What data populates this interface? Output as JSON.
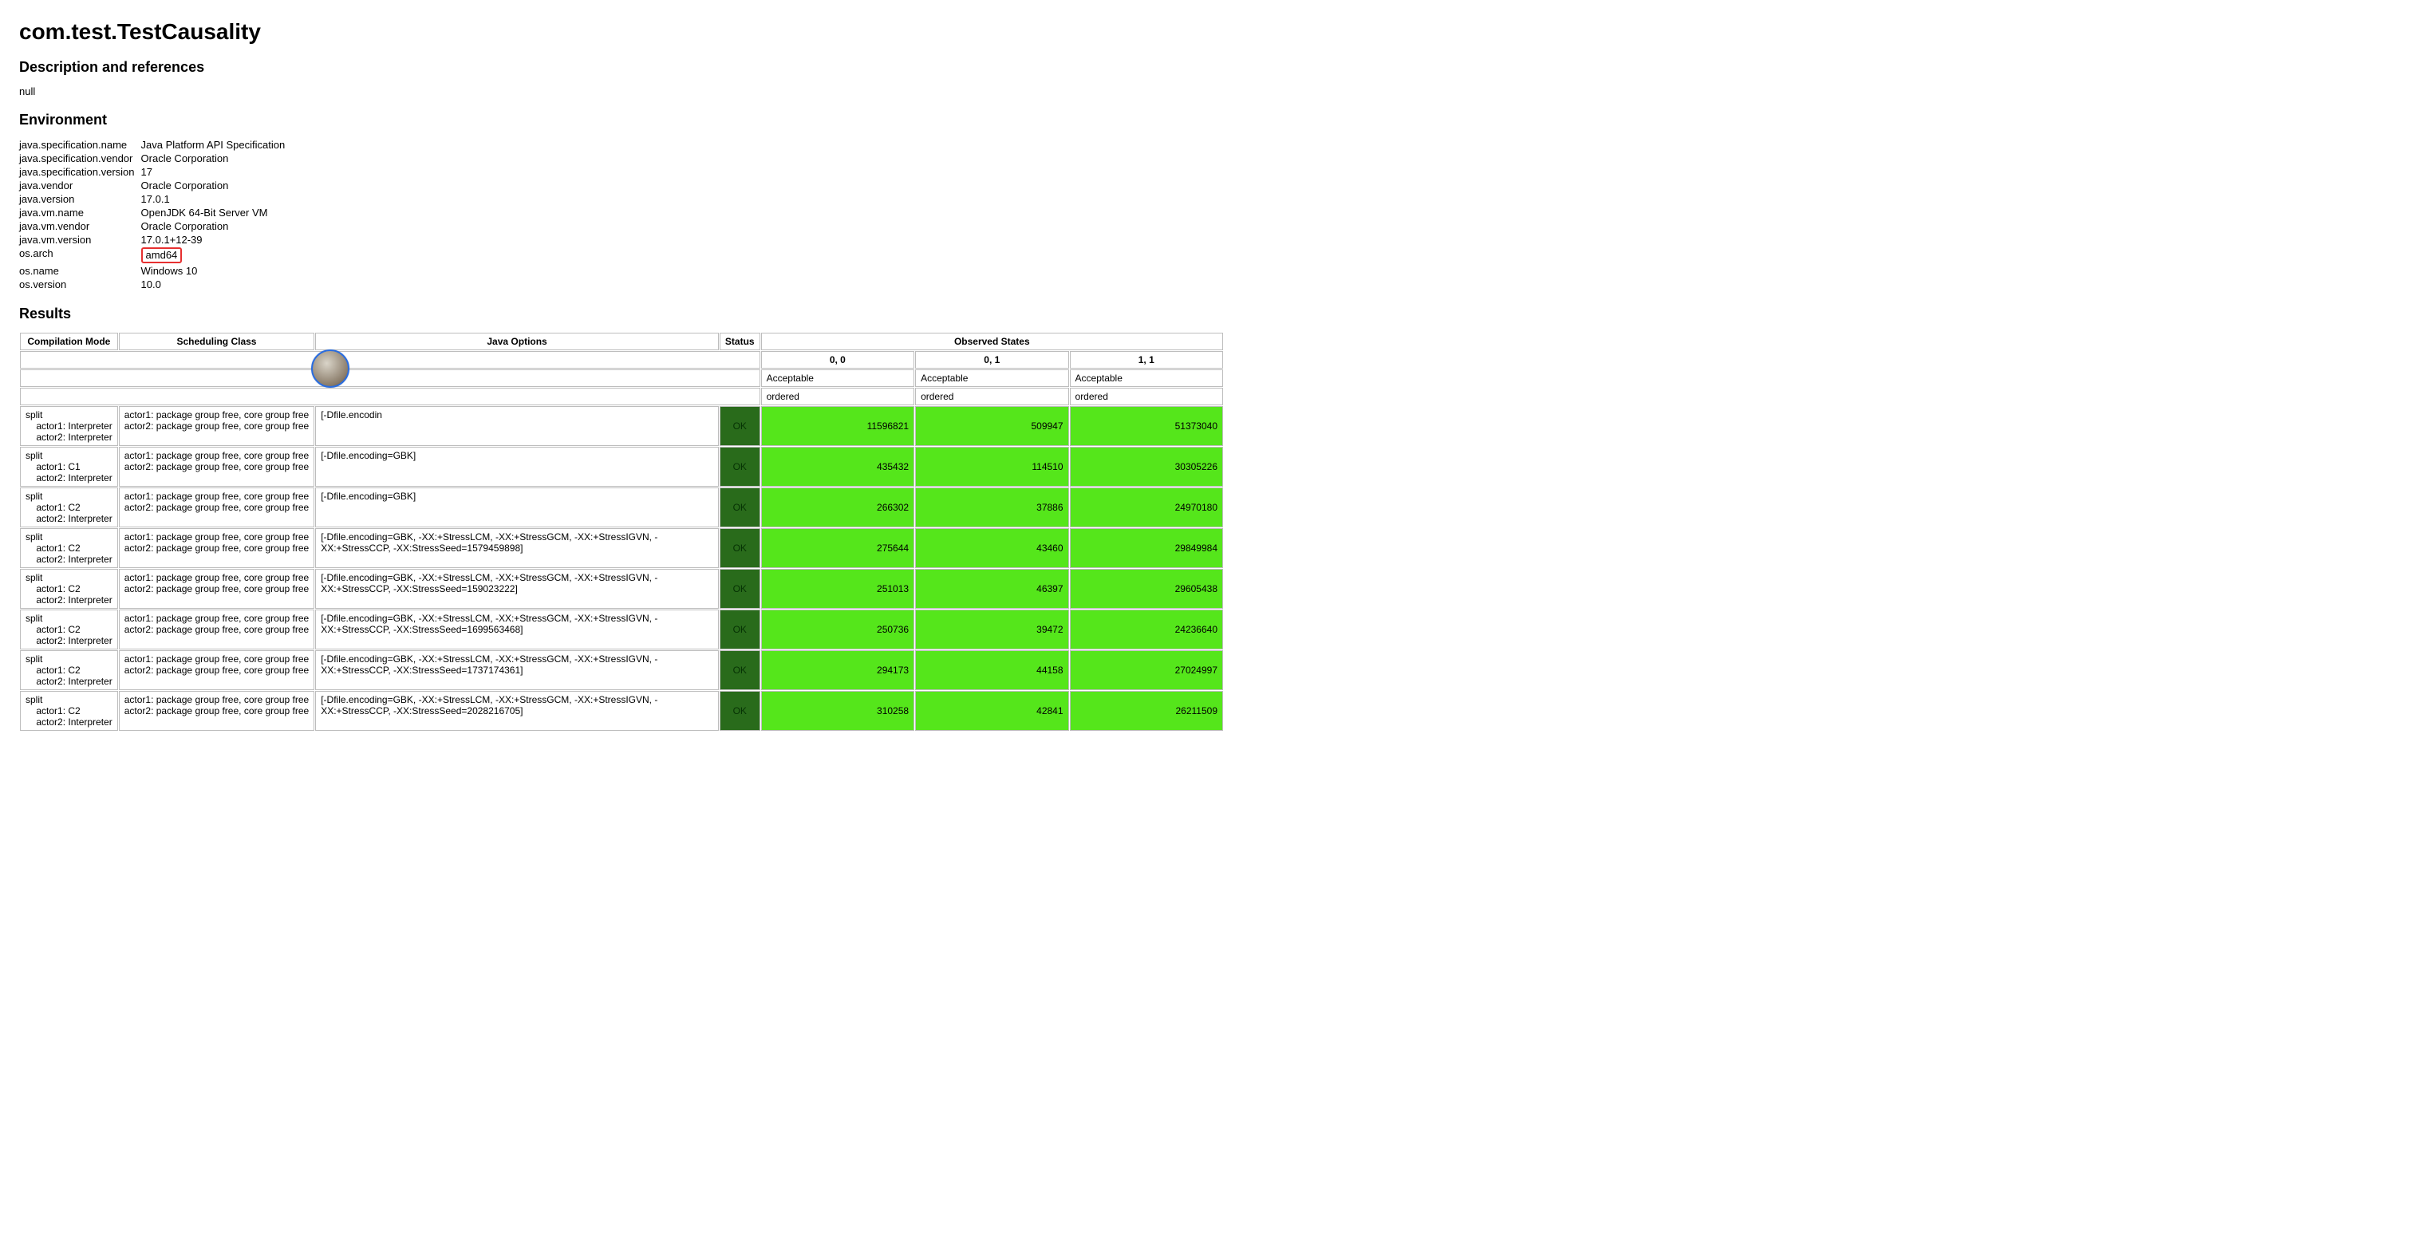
{
  "title": "com.test.TestCausality",
  "descriptionHeading": "Description and references",
  "descriptionText": "null",
  "environmentHeading": "Environment",
  "env": [
    {
      "k": "java.specification.name",
      "v": "Java Platform API Specification"
    },
    {
      "k": "java.specification.vendor",
      "v": "Oracle Corporation"
    },
    {
      "k": "java.specification.version",
      "v": "17"
    },
    {
      "k": "java.vendor",
      "v": "Oracle Corporation"
    },
    {
      "k": "java.version",
      "v": "17.0.1"
    },
    {
      "k": "java.vm.name",
      "v": "OpenJDK 64-Bit Server VM"
    },
    {
      "k": "java.vm.vendor",
      "v": "Oracle Corporation"
    },
    {
      "k": "java.vm.version",
      "v": "17.0.1+12-39"
    },
    {
      "k": "os.arch",
      "v": "amd64",
      "highlight": true
    },
    {
      "k": "os.name",
      "v": "Windows 10"
    },
    {
      "k": "os.version",
      "v": "10.0"
    }
  ],
  "resultsHeading": "Results",
  "columns": {
    "compilation": "Compilation Mode",
    "scheduling": "Scheduling Class",
    "javaOptions": "Java Options",
    "status": "Status",
    "observed": "Observed States"
  },
  "observedHeaders": [
    "0, 0",
    "0, 1",
    "1, 1"
  ],
  "row2Labels": [
    "Acceptable",
    "Acceptable",
    "Acceptable"
  ],
  "row3Labels": [
    "ordered",
    "ordered",
    "ordered"
  ],
  "schedDefault": "actor1: package group free, core group free\nactor2: package group free, core group free",
  "statusOk": "OK",
  "rows": [
    {
      "comp": "split\n    actor1: Interpreter\n    actor2: Interpreter",
      "jopt": "[-Dfile.encodin",
      "counts": [
        "11596821",
        "509947",
        "51373040"
      ]
    },
    {
      "comp": "split\n    actor1: C1\n    actor2: Interpreter",
      "jopt": "[-Dfile.encoding=GBK]",
      "counts": [
        "435432",
        "114510",
        "30305226"
      ]
    },
    {
      "comp": "split\n    actor1: C2\n    actor2: Interpreter",
      "jopt": "[-Dfile.encoding=GBK]",
      "counts": [
        "266302",
        "37886",
        "24970180"
      ]
    },
    {
      "comp": "split\n    actor1: C2\n    actor2: Interpreter",
      "jopt": "[-Dfile.encoding=GBK, -XX:+StressLCM, -XX:+StressGCM, -XX:+StressIGVN, -XX:+StressCCP, -XX:StressSeed=1579459898]",
      "counts": [
        "275644",
        "43460",
        "29849984"
      ]
    },
    {
      "comp": "split\n    actor1: C2\n    actor2: Interpreter",
      "jopt": "[-Dfile.encoding=GBK, -XX:+StressLCM, -XX:+StressGCM, -XX:+StressIGVN, -XX:+StressCCP, -XX:StressSeed=159023222]",
      "counts": [
        "251013",
        "46397",
        "29605438"
      ]
    },
    {
      "comp": "split\n    actor1: C2\n    actor2: Interpreter",
      "jopt": "[-Dfile.encoding=GBK, -XX:+StressLCM, -XX:+StressGCM, -XX:+StressIGVN, -XX:+StressCCP, -XX:StressSeed=1699563468]",
      "counts": [
        "250736",
        "39472",
        "24236640"
      ]
    },
    {
      "comp": "split\n    actor1: C2\n    actor2: Interpreter",
      "jopt": "[-Dfile.encoding=GBK, -XX:+StressLCM, -XX:+StressGCM, -XX:+StressIGVN, -XX:+StressCCP, -XX:StressSeed=1737174361]",
      "counts": [
        "294173",
        "44158",
        "27024997"
      ]
    },
    {
      "comp": "split\n    actor1: C2\n    actor2: Interpreter",
      "jopt": "[-Dfile.encoding=GBK, -XX:+StressLCM, -XX:+StressGCM, -XX:+StressIGVN, -XX:+StressCCP, -XX:StressSeed=2028216705]",
      "counts": [
        "310258",
        "42841",
        "26211509"
      ]
    }
  ]
}
